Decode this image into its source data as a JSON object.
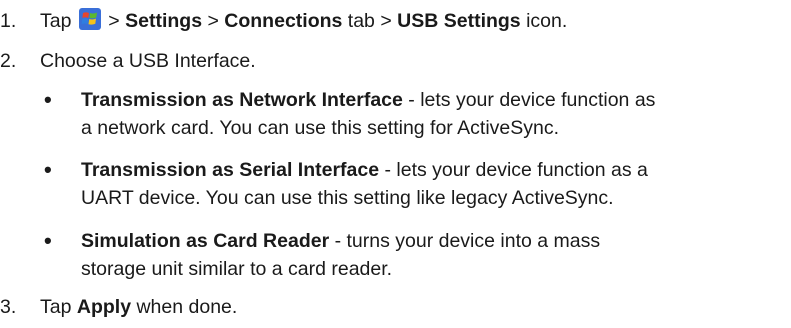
{
  "steps": [
    {
      "number": "1.",
      "parts": {
        "tap": "Tap",
        "sep1": ">",
        "settings": "Settings",
        "sep2": ">",
        "connections": "Connections",
        "tab_word": "tab >",
        "usb_settings": "USB Settings",
        "icon_word": "icon."
      },
      "icon": "windows-start-icon"
    },
    {
      "number": "2.",
      "text": "Choose a USB Interface."
    },
    {
      "number": "3.",
      "tap": "Tap",
      "apply": "Apply",
      "rest": "when done."
    }
  ],
  "bullets": [
    {
      "title": "Transmission as Network Interface",
      "line1": " - lets your device function as",
      "line2": "a network card. You can use this setting for ActiveSync."
    },
    {
      "title": "Transmission as Serial Interface",
      "line1": " - lets your device function as a",
      "line2": "UART device. You can use this setting like legacy ActiveSync."
    },
    {
      "title": "Simulation as Card Reader",
      "line1": " - turns your device into a mass",
      "line2": "storage unit similar to a card reader."
    }
  ],
  "bullet_glyph": "•",
  "colors": {
    "text": "#1a1a1a",
    "logo_red": "#e8452c",
    "logo_green": "#5cb82e",
    "logo_blue": "#2f7ee0",
    "logo_yellow": "#f5c31a",
    "logo_bg": "#3a6fd8"
  }
}
